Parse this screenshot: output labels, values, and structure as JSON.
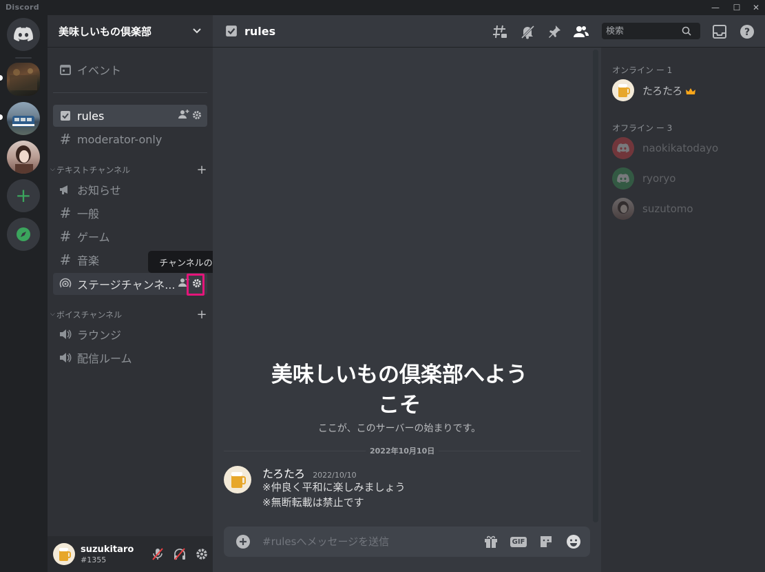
{
  "window": {
    "brand": "Discord"
  },
  "colors": {
    "accent": "#5865f2",
    "green": "#3ba55d",
    "highlight": "#e4157a",
    "crown": "#faa61a"
  },
  "server": {
    "name": "美味しいもの倶楽部",
    "events_label": "イベント",
    "top_channels": [
      {
        "name": "rules",
        "icon": "rules-check-icon"
      },
      {
        "name": "moderator-only",
        "icon": "hash-lock-icon"
      }
    ],
    "text_category": "テキストチャンネル",
    "text_channels": [
      {
        "name": "お知らせ",
        "icon": "megaphone-icon"
      },
      {
        "name": "一般",
        "icon": "hash-icon"
      },
      {
        "name": "ゲーム",
        "icon": "hash-icon"
      },
      {
        "name": "音楽",
        "icon": "hash-icon"
      },
      {
        "name": "ステージチャンネ...",
        "icon": "stage-icon"
      }
    ],
    "voice_category": "ボイスチャンネル",
    "voice_channels": [
      {
        "name": "ラウンジ",
        "icon": "speaker-icon"
      },
      {
        "name": "配信ルーム",
        "icon": "speaker-icon"
      }
    ],
    "tooltip": "チャンネルの編集"
  },
  "user": {
    "name": "suzukitaro",
    "tag": "#1355"
  },
  "chat": {
    "channel_name": "rules",
    "search_placeholder": "検索",
    "welcome_title": "美味しいもの倶楽部へようこそ",
    "welcome_subtitle": "ここが、このサーバーの始まりです。",
    "date_divider": "2022年10月10日",
    "message": {
      "author": "たろたろ",
      "timestamp": "2022/10/10",
      "lines": [
        "※仲良く平和に楽しみましょう",
        "※無断転載は禁止です"
      ]
    },
    "composer_placeholder": "#rulesへメッセージを送信",
    "gif_label": "GIF"
  },
  "members": {
    "online_header": "オンライン ー 1",
    "offline_header": "オフライン ー 3",
    "online": [
      {
        "name": "たろたろ"
      }
    ],
    "offline": [
      {
        "name": "naokikatodayo"
      },
      {
        "name": "ryoryo"
      },
      {
        "name": "suzutomo"
      }
    ]
  }
}
